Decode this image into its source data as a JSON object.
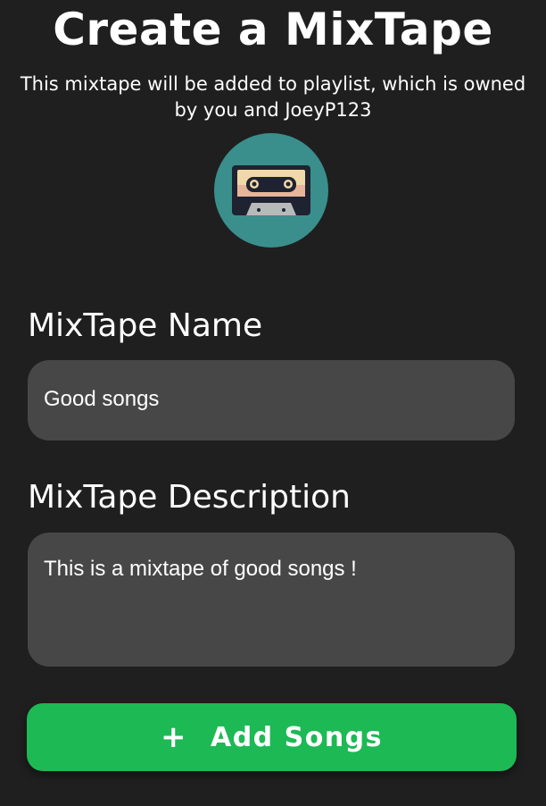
{
  "header": {
    "title": "Create a MixTape",
    "subtitle": "This mixtape will be added to playlist, which is owned by you and JoeyP123"
  },
  "avatar": {
    "icon": "cassette-icon"
  },
  "form": {
    "name_label": "MixTape Name",
    "name_value": "Good songs",
    "description_label": "MixTape Description",
    "description_value": "This is a mixtape of good songs !"
  },
  "actions": {
    "add_icon": "+",
    "add_label": "Add Songs"
  },
  "colors": {
    "background": "#1f1f20",
    "field_background": "#474747",
    "accent": "#1db954",
    "avatar_background": "#3a8f8c"
  }
}
